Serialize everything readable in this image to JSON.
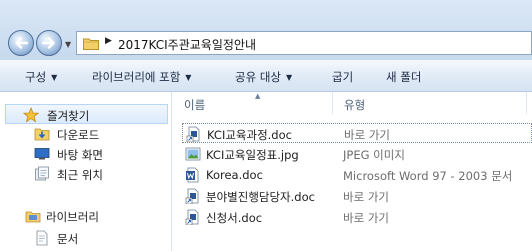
{
  "address": {
    "path": "2017KCI주관교육일정안내"
  },
  "toolbar": {
    "organize": "구성",
    "include_in_library": "라이브러리에 포함",
    "share_with": "공유 대상",
    "burn": "굽기",
    "new_folder": "새 폴더"
  },
  "nav": {
    "favorites": "즐겨찾기",
    "downloads": "다운로드",
    "desktop": "바탕 화면",
    "recent_places": "최근 위치",
    "libraries": "라이브러리",
    "documents": "문서"
  },
  "columns": {
    "name": "이름",
    "type": "유형"
  },
  "files": [
    {
      "name": "KCI교육과정.doc",
      "type": "바로 가기",
      "icon": "shortcut-doc-icon"
    },
    {
      "name": "KCI교육일정표.jpg",
      "type": "JPEG 이미지",
      "icon": "image-icon"
    },
    {
      "name": "Korea.doc",
      "type": "Microsoft Word 97 - 2003 문서",
      "icon": "word-doc-icon"
    },
    {
      "name": "분야별진행담당자.doc",
      "type": "바로 가기",
      "icon": "shortcut-doc-icon"
    },
    {
      "name": "신청서.doc",
      "type": "바로 가기",
      "icon": "shortcut-doc-icon"
    }
  ],
  "colors": {
    "toolbar_bg": "#dbe8f6",
    "selection": "#dbeafc",
    "accent": "#2b579a"
  }
}
